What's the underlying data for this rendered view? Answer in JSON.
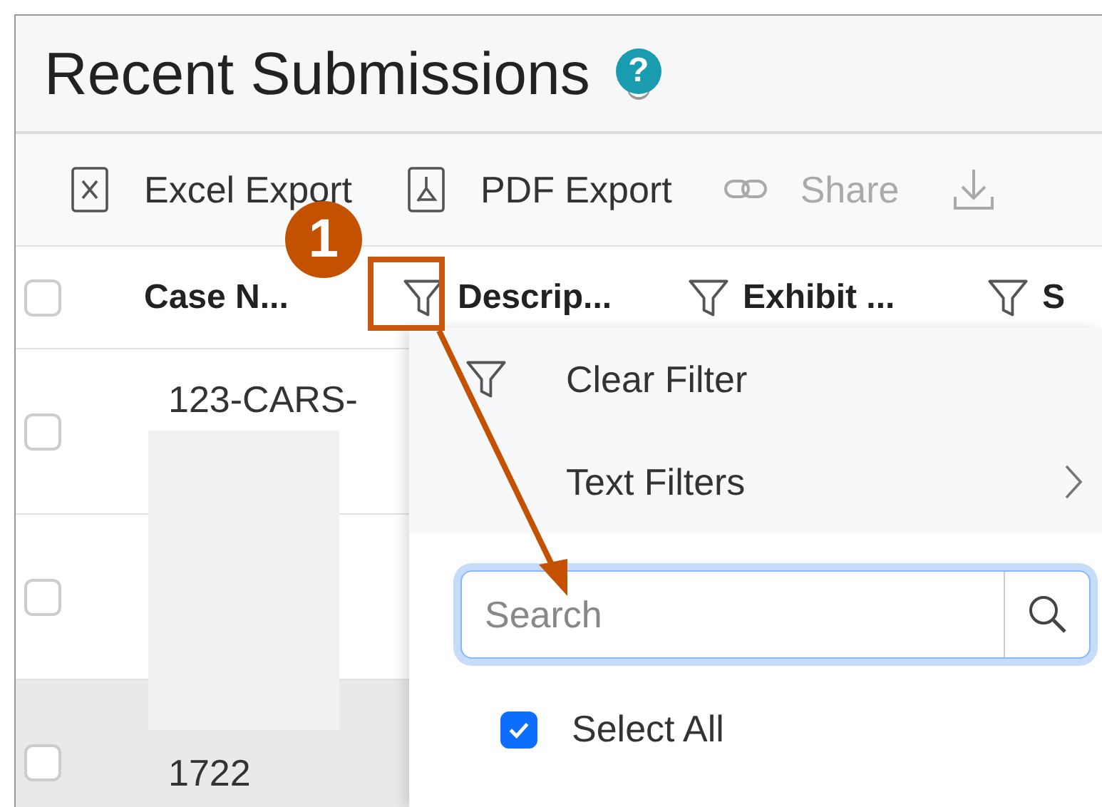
{
  "title": "Recent Submissions",
  "help": "?",
  "toolbar": [
    {
      "label": "Excel Export",
      "kind": "excel",
      "disabled": false
    },
    {
      "label": "PDF Export",
      "kind": "pdf",
      "disabled": false
    },
    {
      "label": "Share",
      "kind": "link",
      "disabled": true
    },
    {
      "kind": "download",
      "disabled": true
    }
  ],
  "header_checkbox": {
    "checked": false
  },
  "columns": [
    {
      "label": "Case N..."
    },
    {
      "label": "Descrip..."
    },
    {
      "label": "Exhibit ..."
    },
    {
      "label": "S"
    }
  ],
  "rows": [
    {
      "checked": false,
      "highlighted": false,
      "case": "123-CARS-"
    },
    {
      "checked": false,
      "highlighted": false
    },
    {
      "checked": false,
      "highlighted": true,
      "case": "1722"
    }
  ],
  "annotation": {
    "number": "1"
  },
  "filter_menu": {
    "items": [
      {
        "label": "Clear Filter",
        "kind": "clear"
      },
      {
        "label": "Text Filters",
        "kind": "submenu"
      }
    ],
    "search": {
      "placeholder": "Search"
    },
    "select_all": {
      "label": "Select All",
      "checked": true
    }
  }
}
